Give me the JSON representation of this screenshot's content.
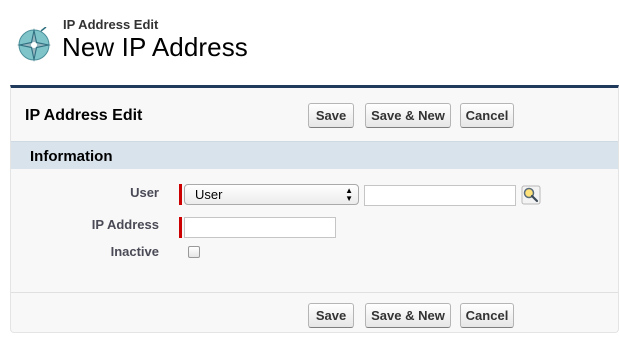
{
  "header": {
    "subtitle": "IP Address Edit",
    "title": "New IP Address",
    "icon": "compass-icon"
  },
  "panel": {
    "title": "IP Address Edit",
    "buttons": {
      "save": "Save",
      "save_new": "Save & New",
      "cancel": "Cancel"
    }
  },
  "section": {
    "title": "Information",
    "fields": {
      "user": {
        "label": "User",
        "select_value": "User",
        "input_value": "",
        "lookup_icon": "lookup-icon"
      },
      "ip_address": {
        "label": "IP Address",
        "value": ""
      },
      "inactive": {
        "label": "Inactive",
        "checked": false
      }
    }
  },
  "colors": {
    "panel_border_top": "#1f3a5a",
    "section_bar": "#d9e3ec",
    "required": "#cc0000"
  }
}
